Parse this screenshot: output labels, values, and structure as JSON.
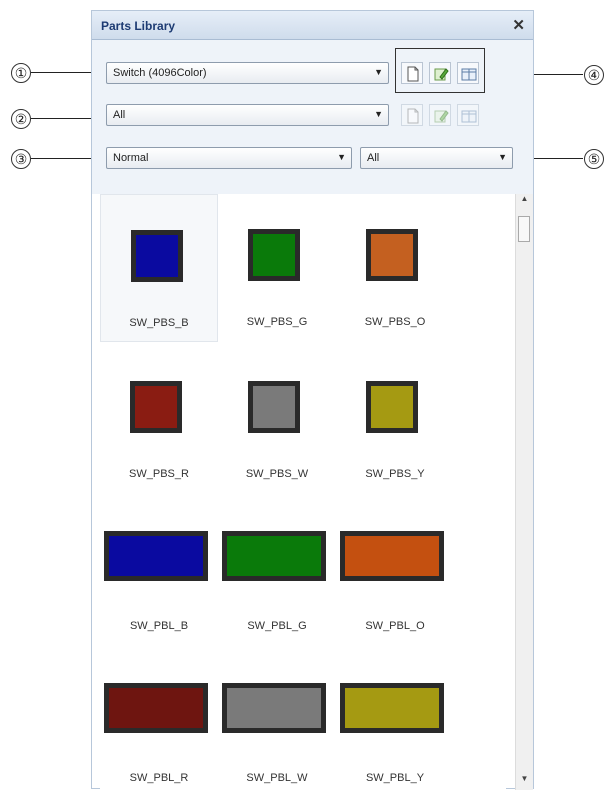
{
  "panel": {
    "title": "Parts Library",
    "close_glyph": "✕"
  },
  "toolbar": {
    "category": {
      "value": "Switch (4096Color)"
    },
    "group": {
      "value": "All"
    },
    "state": {
      "value": "Normal"
    },
    "filter": {
      "value": "All"
    },
    "buttons": [
      {
        "icon": "new-document-icon"
      },
      {
        "icon": "edit-icon"
      },
      {
        "icon": "window-icon"
      }
    ]
  },
  "callouts": [
    "①",
    "②",
    "③",
    "④",
    "⑤"
  ],
  "parts": [
    {
      "label": "SW_PBS_B",
      "color": "#0a0aa0",
      "shape": "square",
      "selected": true
    },
    {
      "label": "SW_PBS_G",
      "color": "#0a7a0a",
      "shape": "square"
    },
    {
      "label": "SW_PBS_O",
      "color": "#c46020",
      "shape": "square"
    },
    {
      "label": "SW_PBS_R",
      "color": "#8a1c12",
      "shape": "square"
    },
    {
      "label": "SW_PBS_W",
      "color": "#7a7a7a",
      "shape": "square"
    },
    {
      "label": "SW_PBS_Y",
      "color": "#a59a12",
      "shape": "square"
    },
    {
      "label": "SW_PBL_B",
      "color": "#0a0aa0",
      "shape": "wide"
    },
    {
      "label": "SW_PBL_G",
      "color": "#0a7a0a",
      "shape": "wide"
    },
    {
      "label": "SW_PBL_O",
      "color": "#c45010",
      "shape": "wide"
    },
    {
      "label": "SW_PBL_R",
      "color": "#6e1510",
      "shape": "wide"
    },
    {
      "label": "SW_PBL_W",
      "color": "#7a7a7a",
      "shape": "wide"
    },
    {
      "label": "SW_PBL_Y",
      "color": "#a59a12",
      "shape": "wide"
    }
  ]
}
